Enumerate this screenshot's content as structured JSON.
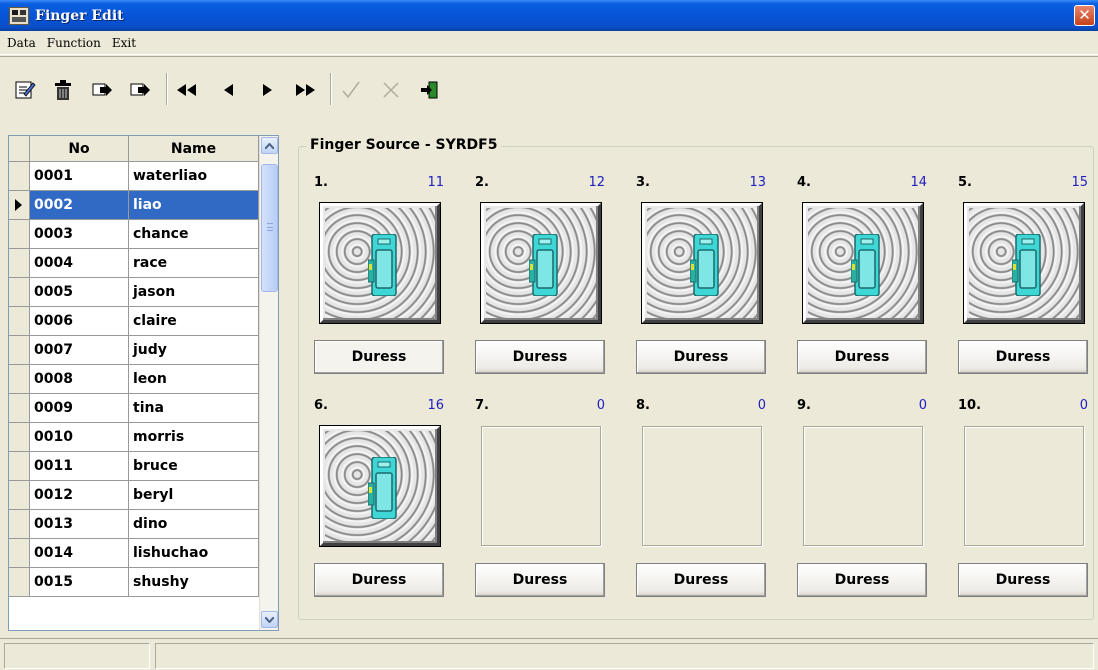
{
  "window": {
    "title": "Finger Edit",
    "close_label": "✕"
  },
  "menu": [
    "Data",
    "Function",
    "Exit"
  ],
  "toolbar": {
    "buttons": [
      {
        "name": "edit-icon",
        "glyph": "✎"
      },
      {
        "name": "delete-trash-icon",
        "glyph": "🗑"
      },
      {
        "name": "import-icon",
        "glyph": "⇨"
      },
      {
        "name": "export-icon",
        "glyph": "⇨"
      },
      {
        "name": "first-record-icon",
        "glyph": "◀◀"
      },
      {
        "name": "previous-record-icon",
        "glyph": "◀"
      },
      {
        "name": "next-record-icon",
        "glyph": "▶"
      },
      {
        "name": "last-record-icon",
        "glyph": "▶▶"
      },
      {
        "name": "confirm-check-icon",
        "glyph": "✓"
      },
      {
        "name": "cancel-x-icon",
        "glyph": "✗"
      },
      {
        "name": "exit-door-icon",
        "glyph": "⇥"
      }
    ]
  },
  "grid": {
    "columns": [
      "No",
      "Name"
    ],
    "selected_index": 1,
    "rows": [
      [
        "0001",
        "waterliao"
      ],
      [
        "0002",
        "liao"
      ],
      [
        "0003",
        "chance"
      ],
      [
        "0004",
        "race"
      ],
      [
        "0005",
        "jason"
      ],
      [
        "0006",
        "claire"
      ],
      [
        "0007",
        "judy"
      ],
      [
        "0008",
        "leon"
      ],
      [
        "0009",
        "tina"
      ],
      [
        "0010",
        "morris"
      ],
      [
        "0011",
        "bruce"
      ],
      [
        "0012",
        "beryl"
      ],
      [
        "0013",
        "dino"
      ],
      [
        "0014",
        "lishuchao"
      ],
      [
        "0015",
        "shushy"
      ]
    ]
  },
  "finger_source": {
    "title": "Finger Source - SYRDF5",
    "duress_label": "Duress",
    "slots": [
      {
        "num": "1.",
        "count": "11",
        "has_print": true
      },
      {
        "num": "2.",
        "count": "12",
        "has_print": true
      },
      {
        "num": "3.",
        "count": "13",
        "has_print": true
      },
      {
        "num": "4.",
        "count": "14",
        "has_print": true
      },
      {
        "num": "5.",
        "count": "15",
        "has_print": true
      },
      {
        "num": "6.",
        "count": "16",
        "has_print": true
      },
      {
        "num": "7.",
        "count": "0",
        "has_print": false
      },
      {
        "num": "8.",
        "count": "0",
        "has_print": false
      },
      {
        "num": "9.",
        "count": "0",
        "has_print": false
      },
      {
        "num": "10.",
        "count": "0",
        "has_print": false
      }
    ]
  },
  "colors": {
    "selection": "#316AC5",
    "count_text": "#2020C0",
    "titlebar": "#0654D8"
  }
}
